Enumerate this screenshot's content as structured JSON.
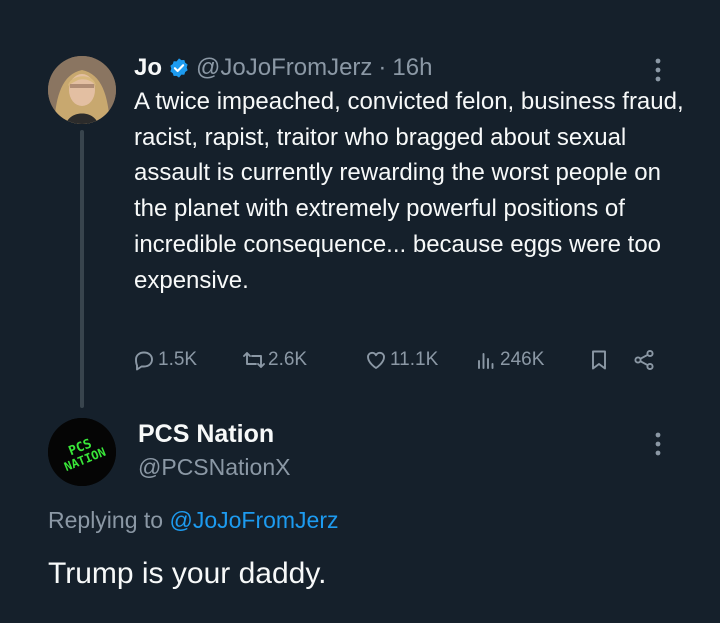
{
  "post": {
    "author_name": "Jo",
    "handle": "@JoJoFromJerz",
    "separator": "·",
    "time": "16h",
    "text": "A twice impeached, convicted felon, business fraud, racist, rapist, traitor who bragged about sexual assault is currently rewarding the worst people on the planet with extremely powerful positions of incredible consequence... because eggs were too expensive.",
    "stats": {
      "replies": "1.5K",
      "reposts": "2.6K",
      "likes": "11.1K",
      "views": "246K"
    }
  },
  "reply": {
    "author_name": "PCS Nation",
    "handle": "@PCSNationX",
    "replying_prefix": "Replying to",
    "replying_handle": "@JoJoFromJerz",
    "text": "Trump is your daddy.",
    "avatar_text_line1": "PCS",
    "avatar_text_line2": "NATION"
  },
  "colors": {
    "background": "#15202b",
    "text": "#f7f9f9",
    "muted": "#8b98a5",
    "accent": "#1d9bf0",
    "avatar_logo": "#39e639"
  },
  "icons": [
    "verified-badge-icon",
    "more-options-icon",
    "reply-icon",
    "repost-icon",
    "like-icon",
    "views-icon",
    "bookmark-icon",
    "share-icon"
  ]
}
